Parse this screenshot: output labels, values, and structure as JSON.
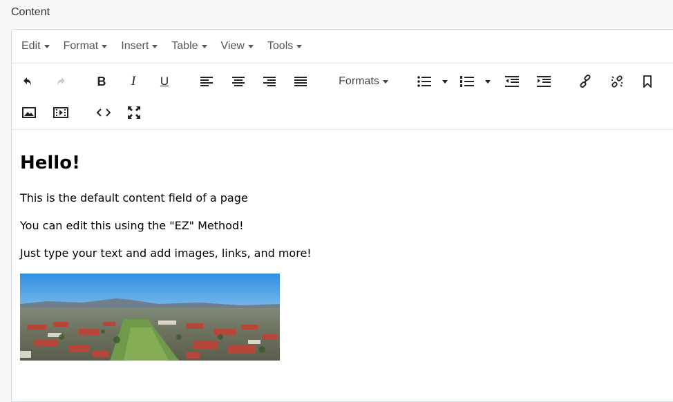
{
  "field": {
    "label": "Content"
  },
  "menubar": {
    "items": [
      {
        "label": "Edit"
      },
      {
        "label": "Format"
      },
      {
        "label": "Insert"
      },
      {
        "label": "Table"
      },
      {
        "label": "View"
      },
      {
        "label": "Tools"
      }
    ]
  },
  "toolbar": {
    "formats_label": "Formats",
    "icons": [
      "undo-icon",
      "redo-icon",
      "bold-icon",
      "italic-icon",
      "underline-icon",
      "align-left-icon",
      "align-center-icon",
      "align-right-icon",
      "align-justify-icon",
      "bullet-list-icon",
      "numbered-list-icon",
      "outdent-icon",
      "indent-icon",
      "link-icon",
      "unlink-icon",
      "bookmark-icon",
      "image-icon",
      "media-icon",
      "source-code-icon",
      "fullscreen-icon"
    ],
    "bold_glyph": "B",
    "italic_glyph": "I",
    "underline_glyph": "U"
  },
  "content": {
    "heading": "Hello!",
    "paragraphs": [
      "This is the default content field of a page",
      "You can edit this using the \"EZ\" Method!",
      "Just type your text and add images, links, and more!"
    ]
  },
  "colors": {
    "accent": "#222f3e",
    "sky": "#4aa3e8",
    "roof": "#b5473a"
  }
}
